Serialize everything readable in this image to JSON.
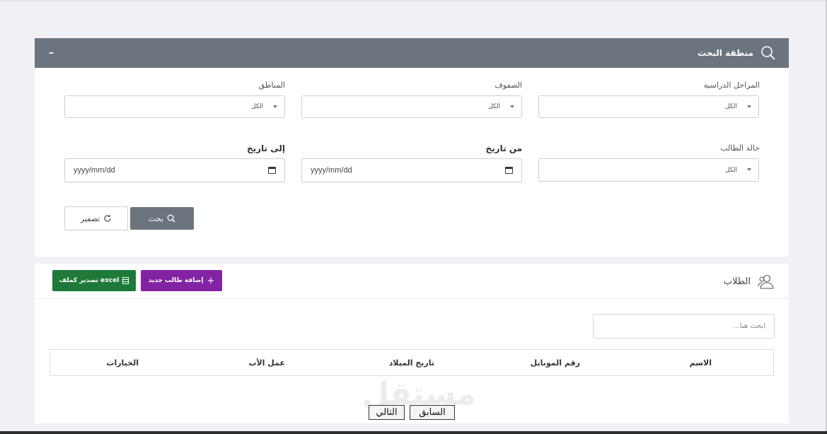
{
  "search_panel": {
    "title": "منطقة البحث",
    "collapse_symbol": "–",
    "fields": {
      "stages": {
        "label": "المراحل الدراسية",
        "value": "الكل"
      },
      "grades": {
        "label": "الصفوف",
        "value": "الكل"
      },
      "regions": {
        "label": "المناطق",
        "value": "الكل"
      },
      "status": {
        "label": "حالة الطالب",
        "value": "الكل"
      },
      "from_date": {
        "label": "من تاريخ",
        "placeholder": "yyyy/mm/dd"
      },
      "to_date": {
        "label": "إلى تاريخ",
        "placeholder": "yyyy/mm/dd"
      }
    },
    "search_button": "بحث",
    "reset_button": "تصفير"
  },
  "students_panel": {
    "title": "الطلاب",
    "add_button": "إضافة طالب جديد",
    "export_button": "excel تصدير كملف",
    "search_placeholder": "ابحث هنا...",
    "columns": [
      "الاسم",
      "رقم الموبايل",
      "تاريخ الميلاد",
      "عمل الأب",
      "الخيارات"
    ]
  },
  "pagination": {
    "previous": "السابق",
    "next": "التالي"
  },
  "watermark": "مستقل",
  "colors": {
    "header_gray": "#6c757d",
    "add_purple": "#8223a3",
    "export_green": "#1f7a3a",
    "background": "#f1f1f5"
  },
  "icons": {
    "search": "magnifier",
    "reset": "refresh",
    "students": "users",
    "add": "plus",
    "export": "spreadsheet",
    "calendar": "calendar"
  }
}
